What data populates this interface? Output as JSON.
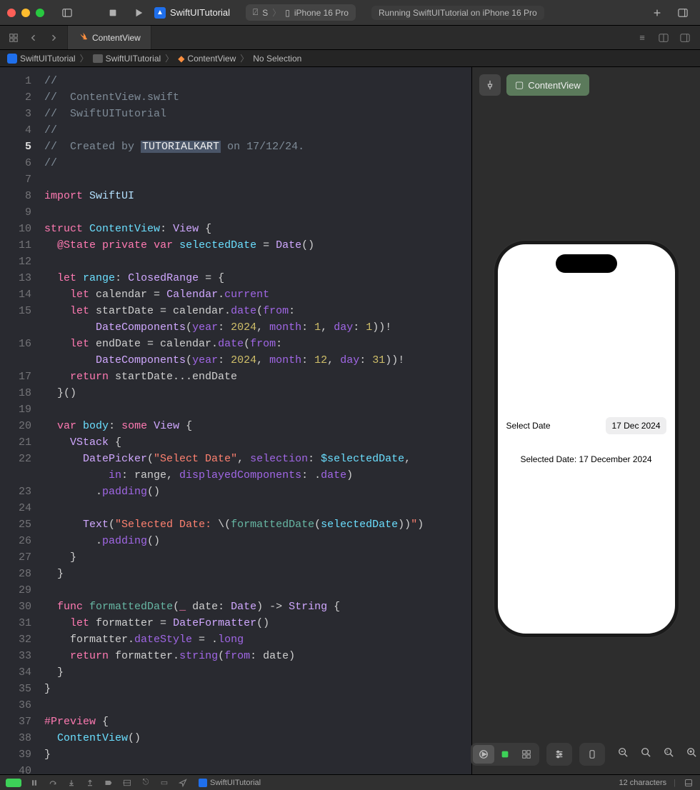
{
  "titlebar": {
    "project": "SwiftUITutorial",
    "scheme": "S",
    "device": "iPhone 16 Pro",
    "status": "Running SwiftUITutorial on iPhone 16 Pro"
  },
  "tab": {
    "name": "ContentView"
  },
  "breadcrumb": {
    "project": "SwiftUITutorial",
    "folder": "SwiftUITutorial",
    "file": "ContentView",
    "selection": "No Selection"
  },
  "code": {
    "lines": [
      {
        "n": 1,
        "seg": [
          {
            "c": "c-comment",
            "t": "//"
          }
        ]
      },
      {
        "n": 2,
        "seg": [
          {
            "c": "c-comment",
            "t": "//  ContentView.swift"
          }
        ]
      },
      {
        "n": 3,
        "seg": [
          {
            "c": "c-comment",
            "t": "//  SwiftUITutorial"
          }
        ]
      },
      {
        "n": 4,
        "seg": [
          {
            "c": "c-comment",
            "t": "//"
          }
        ]
      },
      {
        "n": 5,
        "hl": true,
        "seg": [
          {
            "c": "c-comment",
            "t": "//  Created by "
          },
          {
            "c": "c-sel",
            "t": "TUTORIALKART"
          },
          {
            "c": "c-comment",
            "t": " on 17/12/24."
          }
        ]
      },
      {
        "n": 6,
        "seg": [
          {
            "c": "c-comment",
            "t": "//"
          }
        ]
      },
      {
        "n": 7,
        "seg": [
          {
            "c": "",
            "t": ""
          }
        ]
      },
      {
        "n": 8,
        "seg": [
          {
            "c": "c-keyword",
            "t": "import"
          },
          {
            "c": "",
            "t": " "
          },
          {
            "c": "c-type",
            "t": "SwiftUI"
          }
        ]
      },
      {
        "n": 9,
        "seg": [
          {
            "c": "",
            "t": ""
          }
        ]
      },
      {
        "n": 10,
        "seg": [
          {
            "c": "c-keyword",
            "t": "struct"
          },
          {
            "c": "",
            "t": " "
          },
          {
            "c": "c-ident",
            "t": "ContentView"
          },
          {
            "c": "",
            "t": ": "
          },
          {
            "c": "c-type2",
            "t": "View"
          },
          {
            "c": "",
            "t": " {"
          }
        ]
      },
      {
        "n": 11,
        "seg": [
          {
            "c": "",
            "t": "  "
          },
          {
            "c": "c-attr",
            "t": "@State"
          },
          {
            "c": "",
            "t": " "
          },
          {
            "c": "c-keyword",
            "t": "private"
          },
          {
            "c": "",
            "t": " "
          },
          {
            "c": "c-keyword",
            "t": "var"
          },
          {
            "c": "",
            "t": " "
          },
          {
            "c": "c-ident",
            "t": "selectedDate"
          },
          {
            "c": "",
            "t": " = "
          },
          {
            "c": "c-type2",
            "t": "Date"
          },
          {
            "c": "",
            "t": "()"
          }
        ]
      },
      {
        "n": 12,
        "seg": [
          {
            "c": "",
            "t": ""
          }
        ]
      },
      {
        "n": 13,
        "seg": [
          {
            "c": "",
            "t": "  "
          },
          {
            "c": "c-keyword",
            "t": "let"
          },
          {
            "c": "",
            "t": " "
          },
          {
            "c": "c-ident",
            "t": "range"
          },
          {
            "c": "",
            "t": ": "
          },
          {
            "c": "c-type2",
            "t": "ClosedRange"
          },
          {
            "c": "",
            "t": " = {"
          }
        ]
      },
      {
        "n": 14,
        "seg": [
          {
            "c": "",
            "t": "    "
          },
          {
            "c": "c-keyword",
            "t": "let"
          },
          {
            "c": "",
            "t": " calendar = "
          },
          {
            "c": "c-type2",
            "t": "Calendar"
          },
          {
            "c": "",
            "t": "."
          },
          {
            "c": "c-prop",
            "t": "current"
          }
        ]
      },
      {
        "n": 15,
        "seg": [
          {
            "c": "",
            "t": "    "
          },
          {
            "c": "c-keyword",
            "t": "let"
          },
          {
            "c": "",
            "t": " startDate = calendar."
          },
          {
            "c": "c-prop",
            "t": "date"
          },
          {
            "c": "",
            "t": "("
          },
          {
            "c": "c-prop",
            "t": "from"
          },
          {
            "c": "",
            "t": ":\n        "
          },
          {
            "c": "c-type2",
            "t": "DateComponents"
          },
          {
            "c": "",
            "t": "("
          },
          {
            "c": "c-prop",
            "t": "year"
          },
          {
            "c": "",
            "t": ": "
          },
          {
            "c": "c-num",
            "t": "2024"
          },
          {
            "c": "",
            "t": ", "
          },
          {
            "c": "c-prop",
            "t": "month"
          },
          {
            "c": "",
            "t": ": "
          },
          {
            "c": "c-num",
            "t": "1"
          },
          {
            "c": "",
            "t": ", "
          },
          {
            "c": "c-prop",
            "t": "day"
          },
          {
            "c": "",
            "t": ": "
          },
          {
            "c": "c-num",
            "t": "1"
          },
          {
            "c": "",
            "t": "))!"
          }
        ]
      },
      {
        "n": 16,
        "seg": [
          {
            "c": "",
            "t": "    "
          },
          {
            "c": "c-keyword",
            "t": "let"
          },
          {
            "c": "",
            "t": " endDate = calendar."
          },
          {
            "c": "c-prop",
            "t": "date"
          },
          {
            "c": "",
            "t": "("
          },
          {
            "c": "c-prop",
            "t": "from"
          },
          {
            "c": "",
            "t": ":\n        "
          },
          {
            "c": "c-type2",
            "t": "DateComponents"
          },
          {
            "c": "",
            "t": "("
          },
          {
            "c": "c-prop",
            "t": "year"
          },
          {
            "c": "",
            "t": ": "
          },
          {
            "c": "c-num",
            "t": "2024"
          },
          {
            "c": "",
            "t": ", "
          },
          {
            "c": "c-prop",
            "t": "month"
          },
          {
            "c": "",
            "t": ": "
          },
          {
            "c": "c-num",
            "t": "12"
          },
          {
            "c": "",
            "t": ", "
          },
          {
            "c": "c-prop",
            "t": "day"
          },
          {
            "c": "",
            "t": ": "
          },
          {
            "c": "c-num",
            "t": "31"
          },
          {
            "c": "",
            "t": "))!"
          }
        ]
      },
      {
        "n": 17,
        "seg": [
          {
            "c": "",
            "t": "    "
          },
          {
            "c": "c-keyword",
            "t": "return"
          },
          {
            "c": "",
            "t": " startDate...endDate"
          }
        ]
      },
      {
        "n": 18,
        "seg": [
          {
            "c": "",
            "t": "  }()"
          }
        ]
      },
      {
        "n": 19,
        "seg": [
          {
            "c": "",
            "t": ""
          }
        ]
      },
      {
        "n": 20,
        "seg": [
          {
            "c": "",
            "t": "  "
          },
          {
            "c": "c-keyword",
            "t": "var"
          },
          {
            "c": "",
            "t": " "
          },
          {
            "c": "c-ident",
            "t": "body"
          },
          {
            "c": "",
            "t": ": "
          },
          {
            "c": "c-keyword",
            "t": "some"
          },
          {
            "c": "",
            "t": " "
          },
          {
            "c": "c-type2",
            "t": "View"
          },
          {
            "c": "",
            "t": " {"
          }
        ]
      },
      {
        "n": 21,
        "seg": [
          {
            "c": "",
            "t": "    "
          },
          {
            "c": "c-type2",
            "t": "VStack"
          },
          {
            "c": "",
            "t": " {"
          }
        ]
      },
      {
        "n": 22,
        "seg": [
          {
            "c": "",
            "t": "      "
          },
          {
            "c": "c-type2",
            "t": "DatePicker"
          },
          {
            "c": "",
            "t": "("
          },
          {
            "c": "c-string",
            "t": "\"Select Date\""
          },
          {
            "c": "",
            "t": ", "
          },
          {
            "c": "c-prop",
            "t": "selection"
          },
          {
            "c": "",
            "t": ": "
          },
          {
            "c": "c-ident",
            "t": "$selectedDate"
          },
          {
            "c": "",
            "t": ",\n          "
          },
          {
            "c": "c-prop",
            "t": "in"
          },
          {
            "c": "",
            "t": ": range, "
          },
          {
            "c": "c-prop",
            "t": "displayedComponents"
          },
          {
            "c": "",
            "t": ": ."
          },
          {
            "c": "c-prop",
            "t": "date"
          },
          {
            "c": "",
            "t": ")"
          }
        ]
      },
      {
        "n": 23,
        "seg": [
          {
            "c": "",
            "t": "        ."
          },
          {
            "c": "c-prop",
            "t": "padding"
          },
          {
            "c": "",
            "t": "()"
          }
        ]
      },
      {
        "n": 24,
        "seg": [
          {
            "c": "",
            "t": ""
          }
        ]
      },
      {
        "n": 25,
        "seg": [
          {
            "c": "",
            "t": "      "
          },
          {
            "c": "c-type2",
            "t": "Text"
          },
          {
            "c": "",
            "t": "("
          },
          {
            "c": "c-string",
            "t": "\"Selected Date: "
          },
          {
            "c": "",
            "t": "\\("
          },
          {
            "c": "c-func",
            "t": "formattedDate"
          },
          {
            "c": "",
            "t": "("
          },
          {
            "c": "c-ident",
            "t": "selectedDate"
          },
          {
            "c": "",
            "t": "))"
          },
          {
            "c": "c-string",
            "t": "\""
          },
          {
            "c": "",
            "t": ")"
          }
        ]
      },
      {
        "n": 26,
        "seg": [
          {
            "c": "",
            "t": "        ."
          },
          {
            "c": "c-prop",
            "t": "padding"
          },
          {
            "c": "",
            "t": "()"
          }
        ]
      },
      {
        "n": 27,
        "seg": [
          {
            "c": "",
            "t": "    }"
          }
        ]
      },
      {
        "n": 28,
        "seg": [
          {
            "c": "",
            "t": "  }"
          }
        ]
      },
      {
        "n": 29,
        "seg": [
          {
            "c": "",
            "t": ""
          }
        ]
      },
      {
        "n": 30,
        "seg": [
          {
            "c": "",
            "t": "  "
          },
          {
            "c": "c-keyword",
            "t": "func"
          },
          {
            "c": "",
            "t": " "
          },
          {
            "c": "c-func",
            "t": "formattedDate"
          },
          {
            "c": "",
            "t": "("
          },
          {
            "c": "c-keyword",
            "t": "_"
          },
          {
            "c": "",
            "t": " date: "
          },
          {
            "c": "c-type2",
            "t": "Date"
          },
          {
            "c": "",
            "t": ") -> "
          },
          {
            "c": "c-type2",
            "t": "String"
          },
          {
            "c": "",
            "t": " {"
          }
        ]
      },
      {
        "n": 31,
        "seg": [
          {
            "c": "",
            "t": "    "
          },
          {
            "c": "c-keyword",
            "t": "let"
          },
          {
            "c": "",
            "t": " formatter = "
          },
          {
            "c": "c-type2",
            "t": "DateFormatter"
          },
          {
            "c": "",
            "t": "()"
          }
        ]
      },
      {
        "n": 32,
        "seg": [
          {
            "c": "",
            "t": "    formatter."
          },
          {
            "c": "c-prop",
            "t": "dateStyle"
          },
          {
            "c": "",
            "t": " = ."
          },
          {
            "c": "c-prop",
            "t": "long"
          }
        ]
      },
      {
        "n": 33,
        "seg": [
          {
            "c": "",
            "t": "    "
          },
          {
            "c": "c-keyword",
            "t": "return"
          },
          {
            "c": "",
            "t": " formatter."
          },
          {
            "c": "c-prop",
            "t": "string"
          },
          {
            "c": "",
            "t": "("
          },
          {
            "c": "c-prop",
            "t": "from"
          },
          {
            "c": "",
            "t": ": date)"
          }
        ]
      },
      {
        "n": 34,
        "seg": [
          {
            "c": "",
            "t": "  }"
          }
        ]
      },
      {
        "n": 35,
        "seg": [
          {
            "c": "",
            "t": "}"
          }
        ]
      },
      {
        "n": 36,
        "seg": [
          {
            "c": "",
            "t": ""
          }
        ]
      },
      {
        "n": 37,
        "seg": [
          {
            "c": "c-attr",
            "t": "#Preview"
          },
          {
            "c": "",
            "t": " {"
          }
        ]
      },
      {
        "n": 38,
        "seg": [
          {
            "c": "",
            "t": "  "
          },
          {
            "c": "c-ident",
            "t": "ContentView"
          },
          {
            "c": "",
            "t": "()"
          }
        ]
      },
      {
        "n": 39,
        "seg": [
          {
            "c": "",
            "t": "}"
          }
        ]
      },
      {
        "n": 40,
        "seg": [
          {
            "c": "",
            "t": ""
          }
        ]
      }
    ]
  },
  "preview": {
    "tab": "ContentView",
    "datepicker_label": "Select Date",
    "datepicker_value": "17 Dec 2024",
    "selected_text": "Selected Date: 17 December 2024"
  },
  "statusbar": {
    "project": "SwiftUITutorial",
    "chars": "12 characters"
  }
}
